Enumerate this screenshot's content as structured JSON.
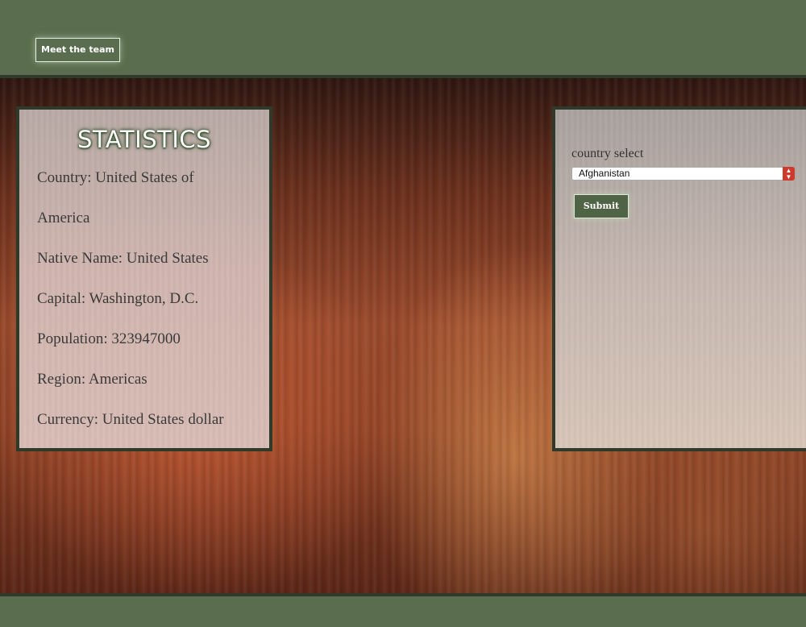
{
  "header": {
    "team_button_label": "Meet the team"
  },
  "stats": {
    "title": "STATISTICS",
    "lines": [
      "Country: United States of",
      "America",
      "Native Name: United States",
      "Capital: Washington, D.C.",
      "Population: 323947000",
      "Region: Americas",
      "Currency: United States dollar"
    ]
  },
  "selector": {
    "label": "country select",
    "selected_country": "Afghanistan",
    "submit_label": "Submit"
  },
  "icons": {
    "select_arrow": "chevron-up-down-icon"
  },
  "colors": {
    "bar_green": "#5a6d4e",
    "border_dark": "#2f3a2b",
    "select_accent": "#cc3b2b"
  }
}
